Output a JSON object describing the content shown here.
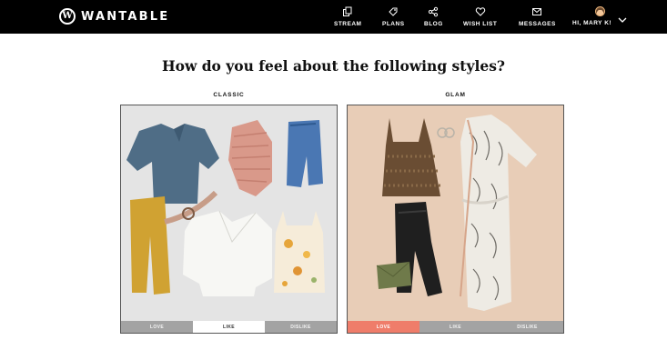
{
  "brand": {
    "name": "WANTABLE",
    "mark": "W"
  },
  "nav": {
    "items": [
      {
        "id": "stream",
        "label": "STREAM",
        "icon": "stream-icon"
      },
      {
        "id": "plans",
        "label": "PLANS",
        "icon": "tag-icon"
      },
      {
        "id": "blog",
        "label": "BLOG",
        "icon": "share-icon"
      },
      {
        "id": "wishlist",
        "label": "WISH LIST",
        "icon": "heart-icon"
      },
      {
        "id": "messages",
        "label": "MESSAGES",
        "icon": "envelope-icon"
      }
    ],
    "user": {
      "label": "HI, MARY K!",
      "avatar": "avatar-icon",
      "menu_icon": "chevron-down-icon"
    }
  },
  "page": {
    "title": "How do you feel about the following styles?"
  },
  "styles": [
    {
      "label": "CLASSIC",
      "image_icon": "classic-outfit-photo",
      "options": [
        "LOVE",
        "LIKE",
        "DISLIKE"
      ],
      "selected": "LIKE"
    },
    {
      "label": "GLAM",
      "image_icon": "glam-outfit-photo",
      "options": [
        "LOVE",
        "LIKE",
        "DISLIKE"
      ],
      "selected": "LOVE"
    }
  ],
  "colors": {
    "topbar": "#000000",
    "rating_bar": "#a3a3a3",
    "love_selected": "#ef7d6a",
    "like_selected": "#ffffff",
    "classic_bg": "#e6e6e6",
    "glam_bg": "#e8cdb8"
  }
}
